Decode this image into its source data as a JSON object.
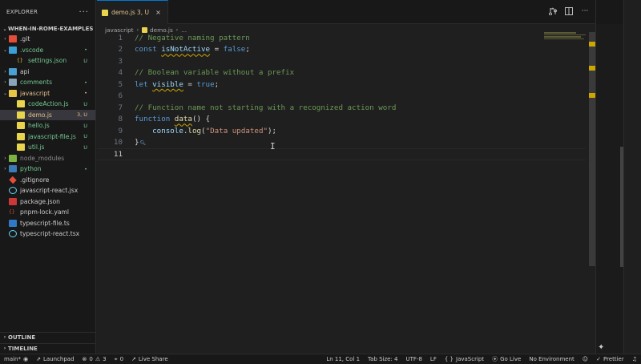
{
  "explorer": {
    "title": "EXPLORER",
    "more": "···",
    "root_label": "WHEN-IN-ROME-EXAMPLES",
    "items": [
      {
        "name": ".git",
        "badge": "",
        "kind": "folder-git",
        "chevron": "›",
        "indent": 0,
        "name_color": "#cccccc",
        "badge_color": ""
      },
      {
        "name": ".vscode",
        "badge": "•",
        "kind": "folder-vscode",
        "chevron": "⌄",
        "indent": 0,
        "name_color": "#73c991",
        "badge_color": "#73c991"
      },
      {
        "name": "settings.json",
        "badge": "U",
        "kind": "json",
        "chevron": "",
        "indent": 1,
        "name_color": "#73c991",
        "badge_color": "#73c991"
      },
      {
        "name": "api",
        "badge": "",
        "kind": "folder-api",
        "chevron": "›",
        "indent": 0,
        "name_color": "#cccccc",
        "badge_color": ""
      },
      {
        "name": "comments",
        "badge": "•",
        "kind": "folder",
        "chevron": "›",
        "indent": 0,
        "name_color": "#73c991",
        "badge_color": "#73c991"
      },
      {
        "name": "javascript",
        "badge": "•",
        "kind": "folder-js",
        "chevron": "⌄",
        "indent": 0,
        "name_color": "#e2c08d",
        "badge_color": "#e2c08d"
      },
      {
        "name": "codeAction.js",
        "badge": "U",
        "kind": "js",
        "chevron": "",
        "indent": 1,
        "name_color": "#73c991",
        "badge_color": "#73c991"
      },
      {
        "name": "demo.js",
        "badge": "3, U",
        "kind": "js",
        "chevron": "",
        "indent": 1,
        "name_color": "#e2c08d",
        "badge_color": "#e2c08d",
        "selected": true
      },
      {
        "name": "hello.js",
        "badge": "U",
        "kind": "js",
        "chevron": "",
        "indent": 1,
        "name_color": "#73c991",
        "badge_color": "#73c991"
      },
      {
        "name": "javascript-file.js",
        "badge": "U",
        "kind": "js",
        "chevron": "",
        "indent": 1,
        "name_color": "#73c991",
        "badge_color": "#73c991"
      },
      {
        "name": "util.js",
        "badge": "U",
        "kind": "js",
        "chevron": "",
        "indent": 1,
        "name_color": "#73c991",
        "badge_color": "#73c991"
      },
      {
        "name": "node_modules",
        "badge": "",
        "kind": "folder-node",
        "chevron": "›",
        "indent": 0,
        "name_color": "#8c8c8c",
        "badge_color": ""
      },
      {
        "name": "python",
        "badge": "•",
        "kind": "folder-py",
        "chevron": "›",
        "indent": 0,
        "name_color": "#73c991",
        "badge_color": "#73c991"
      },
      {
        "name": ".gitignore",
        "badge": "",
        "kind": "gitignore",
        "chevron": "",
        "indent": 0,
        "name_color": "#cccccc",
        "badge_color": ""
      },
      {
        "name": "javascript-react.jsx",
        "badge": "",
        "kind": "react",
        "chevron": "",
        "indent": 0,
        "name_color": "#cccccc",
        "badge_color": ""
      },
      {
        "name": "package.json",
        "badge": "",
        "kind": "npm",
        "chevron": "",
        "indent": 0,
        "name_color": "#cccccc",
        "badge_color": ""
      },
      {
        "name": "pnpm-lock.yaml",
        "badge": "",
        "kind": "yaml",
        "chevron": "",
        "indent": 0,
        "name_color": "#cccccc",
        "badge_color": ""
      },
      {
        "name": "typescript-file.ts",
        "badge": "",
        "kind": "ts",
        "chevron": "",
        "indent": 0,
        "name_color": "#cccccc",
        "badge_color": ""
      },
      {
        "name": "typescript-react.tsx",
        "badge": "",
        "kind": "react",
        "chevron": "",
        "indent": 0,
        "name_color": "#cccccc",
        "badge_color": ""
      }
    ],
    "outline": "OUTLINE",
    "timeline": "TIMELINE"
  },
  "editor": {
    "tab_label": "demo.js",
    "tab_badge": "3, U",
    "tab_close": "×",
    "breadcrumb": {
      "folder": "javascript",
      "file": "demo.js",
      "symbol": "..."
    },
    "active_line": 11,
    "lines": [
      [
        {
          "t": "// Negative naming pattern",
          "c": "comment"
        }
      ],
      [
        {
          "t": "const ",
          "c": "kw"
        },
        {
          "t": "isNotActive",
          "c": "var",
          "sq": true
        },
        {
          "t": " = ",
          "c": "op"
        },
        {
          "t": "false",
          "c": "kw"
        },
        {
          "t": ";",
          "c": "op"
        }
      ],
      [],
      [
        {
          "t": "// Boolean variable without a prefix",
          "c": "comment"
        }
      ],
      [
        {
          "t": "let ",
          "c": "kw"
        },
        {
          "t": "visible",
          "c": "var",
          "sq": true
        },
        {
          "t": " = ",
          "c": "op"
        },
        {
          "t": "true",
          "c": "kw"
        },
        {
          "t": ";",
          "c": "op"
        }
      ],
      [],
      [
        {
          "t": "// Function name not starting with a recognized action word",
          "c": "comment"
        }
      ],
      [
        {
          "t": "function ",
          "c": "kw"
        },
        {
          "t": "data",
          "c": "fn",
          "sq": true
        },
        {
          "t": "() {",
          "c": "op"
        }
      ],
      [
        {
          "t": "    console",
          "c": "var"
        },
        {
          "t": ".",
          "c": "op"
        },
        {
          "t": "log",
          "c": "fn"
        },
        {
          "t": "(",
          "c": "op"
        },
        {
          "t": "\"Data updated\"",
          "c": "str"
        },
        {
          "t": ");",
          "c": "op"
        }
      ],
      [
        {
          "t": "}",
          "c": "op"
        }
      ],
      []
    ]
  },
  "statusbar": {
    "branch": "main*",
    "launchpad": "Launchpad",
    "errors": "0",
    "warnings": "3",
    "ports": "0",
    "live_share": "Live Share",
    "cursor": "Ln 11, Col 1",
    "tab_size": "Tab Size: 4",
    "encoding": "UTF-8",
    "eol": "LF",
    "language": "JavaScript",
    "go_live": "Go Live",
    "environment": "No Environment",
    "prettier": "Prettier"
  },
  "colors": {
    "accent": "#0078d4",
    "untracked": "#73c991",
    "modified": "#e2c08d",
    "warning": "#cca700"
  }
}
